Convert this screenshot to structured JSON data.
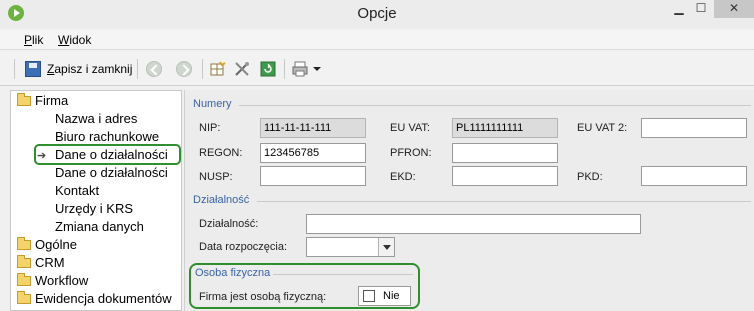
{
  "window": {
    "title": "Opcje"
  },
  "menu": {
    "items": [
      {
        "accel": "P",
        "rest": "lik"
      },
      {
        "accel": "W",
        "rest": "idok"
      }
    ]
  },
  "toolbar": {
    "save_accel": "Z",
    "save_rest": "apisz i zamknij"
  },
  "tree": {
    "root": "Firma",
    "children": [
      "Nazwa i adres",
      "Biuro rachunkowe",
      "Dane o działalności",
      "Dane o działalności",
      "Kontakt",
      "Urzędy i KRS",
      "Zmiana danych"
    ],
    "folders": [
      "Ogólne",
      "CRM",
      "Workflow",
      "Ewidencja dokumentów"
    ]
  },
  "numery": {
    "title": "Numery",
    "nip_label": "NIP:",
    "nip_value": "111-11-11-111",
    "euvat_label": "EU VAT:",
    "euvat_value": "PL1111111111",
    "euvat2_label": "EU VAT 2:",
    "euvat2_value": "",
    "regon_label": "REGON:",
    "regon_value": "123456785",
    "pfron_label": "PFRON:",
    "pfron_value": "",
    "nusp_label": "NUSP:",
    "nusp_value": "",
    "ekd_label": "EKD:",
    "ekd_value": "",
    "pkd_label": "PKD:",
    "pkd_value": ""
  },
  "dzialalnosc": {
    "title": "Działalność",
    "dzial_label": "Działalność:",
    "dzial_value": "",
    "data_label": "Data rozpoczęcia:",
    "data_value": ""
  },
  "osoba": {
    "title": "Osoba fizyczna",
    "label": "Firma jest osobą fizyczną:",
    "checkbox_text": "Nie"
  }
}
